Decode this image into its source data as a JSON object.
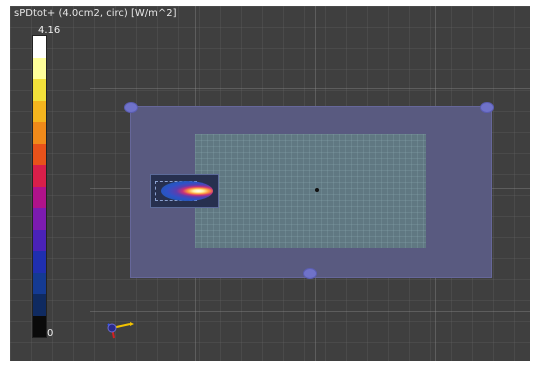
{
  "scene": {
    "title": "sPDtot+ (4.0cm2, circ) [W/m^2]"
  },
  "colorbar": {
    "max_label": "4.16",
    "min_label": "0",
    "colors": [
      "#ffffff",
      "#ffff9a",
      "#f3e13a",
      "#f5b51e",
      "#f08a1a",
      "#e8521a",
      "#d81f4a",
      "#b0128a",
      "#7c1bb0",
      "#4a22b8",
      "#1f2fb0",
      "#143a92",
      "#0f2a60",
      "#0a0a0a"
    ]
  },
  "icons": {
    "axis_gizmo": "axis-gizmo-icon"
  }
}
